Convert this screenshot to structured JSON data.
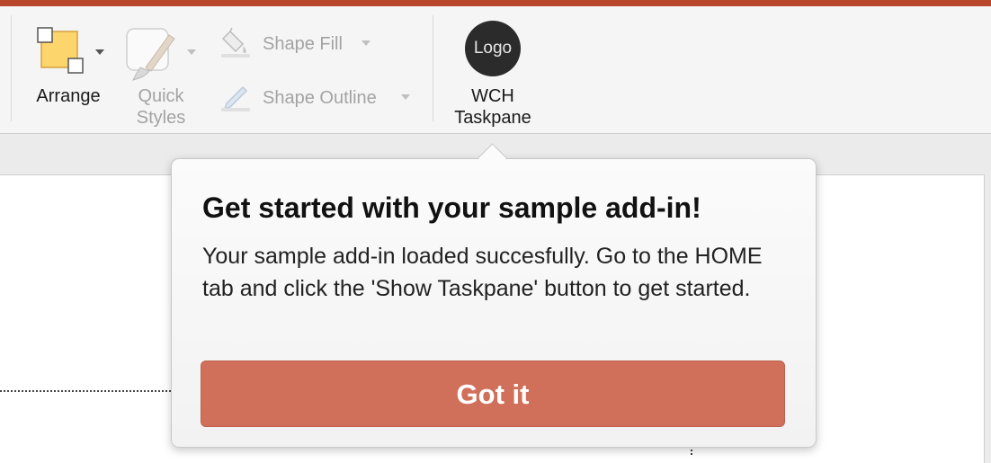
{
  "ribbon": {
    "arrange_label": "Arrange",
    "quick_styles_label_1": "Quick",
    "quick_styles_label_2": "Styles",
    "shape_fill_label": "Shape Fill",
    "shape_outline_label": "Shape Outline",
    "logo_text": "Logo",
    "wch_label_1": "WCH",
    "wch_label_2": "Taskpane"
  },
  "callout": {
    "title": "Get started with your sample add-in!",
    "body": "Your sample add-in loaded succesfully. Go to the HOME tab and click the 'Show Taskpane' button to get started.",
    "button_label": "Got it"
  },
  "colors": {
    "accent_bar": "#b8462b",
    "button_fill": "#d0705b",
    "logo_circle": "#2b2b2b"
  },
  "icons": {
    "arrange": "arrange-icon",
    "quick_styles": "quick-styles-icon",
    "shape_fill": "paint-bucket-icon",
    "shape_outline": "pencil-icon",
    "logo": "logo-icon"
  }
}
